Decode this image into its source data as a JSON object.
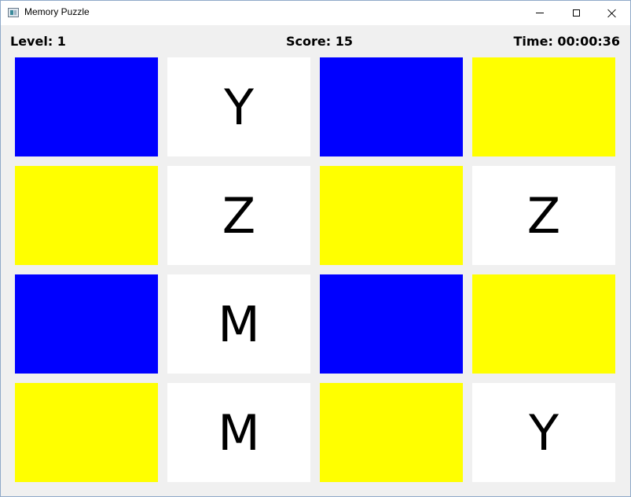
{
  "window": {
    "title": "Memory Puzzle",
    "icon": "app-window-icon",
    "controls": [
      "minimize-icon",
      "maximize-icon",
      "close-icon"
    ]
  },
  "hud": {
    "level": "Level: 1",
    "score": "Score: 15",
    "time": "Time: 00:00:36"
  },
  "colors": {
    "blue": "#0000ff",
    "yellow": "#ffff00",
    "revealed": "#ffffff",
    "background": "#f0f0f0"
  },
  "board": {
    "rows": 4,
    "cols": 4,
    "cards": [
      {
        "state": "hidden",
        "color": "#0000ff",
        "letter": ""
      },
      {
        "state": "revealed",
        "color": "#ffffff",
        "letter": "Y"
      },
      {
        "state": "hidden",
        "color": "#0000ff",
        "letter": ""
      },
      {
        "state": "hidden",
        "color": "#ffff00",
        "letter": ""
      },
      {
        "state": "hidden",
        "color": "#ffff00",
        "letter": ""
      },
      {
        "state": "revealed",
        "color": "#ffffff",
        "letter": "Z"
      },
      {
        "state": "hidden",
        "color": "#ffff00",
        "letter": ""
      },
      {
        "state": "revealed",
        "color": "#ffffff",
        "letter": "Z"
      },
      {
        "state": "hidden",
        "color": "#0000ff",
        "letter": ""
      },
      {
        "state": "revealed",
        "color": "#ffffff",
        "letter": "M"
      },
      {
        "state": "hidden",
        "color": "#0000ff",
        "letter": ""
      },
      {
        "state": "hidden",
        "color": "#ffff00",
        "letter": ""
      },
      {
        "state": "hidden",
        "color": "#ffff00",
        "letter": ""
      },
      {
        "state": "revealed",
        "color": "#ffffff",
        "letter": "M"
      },
      {
        "state": "hidden",
        "color": "#ffff00",
        "letter": ""
      },
      {
        "state": "revealed",
        "color": "#ffffff",
        "letter": "Y"
      }
    ]
  }
}
